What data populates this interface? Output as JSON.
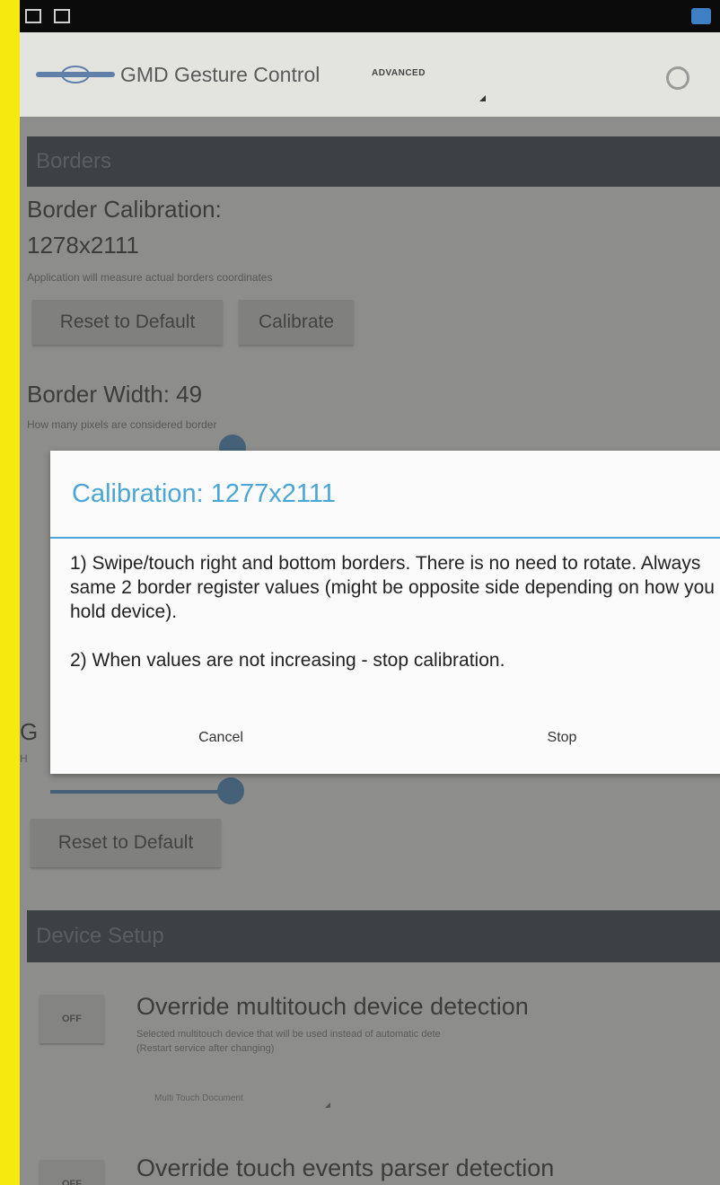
{
  "action_bar": {
    "app_title": "GMD Gesture Control",
    "mode_label": "ADVANCED",
    "settings_icon": "wrench-icon",
    "logo_icon": "gmd-logo-icon"
  },
  "borders_section": {
    "header": "Borders",
    "calibration": {
      "title": "Border Calibration:",
      "value": "1278x2111",
      "description": "Application will measure actual borders coordinates",
      "reset_label": "Reset to Default",
      "calibrate_label": "Calibrate"
    },
    "border_width": {
      "title": "Border Width: 49",
      "description": "How many pixels are considered border"
    }
  },
  "gesture_section": {
    "title_letter": "G",
    "hint_letter": "H",
    "reset_label": "Reset to Default"
  },
  "device_setup": {
    "header": "Device Setup",
    "rows": [
      {
        "badge": "OFF",
        "title": "Override multitouch device detection",
        "subtitle": "Selected multitouch device that will be used instead of automatic dete",
        "subtitle2": "(Restart service after changing)",
        "spinner": "Multi Touch Document"
      },
      {
        "badge": "OFF",
        "title": "Override touch events parser detection"
      }
    ]
  },
  "dialog": {
    "title": "Calibration: 1277x2111",
    "body_1": "1) Swipe/touch right and bottom borders. There is no need to rotate. Always same 2 border register values (might be opposite side depending on how you hold device).",
    "body_2": "2) When values are not increasing - stop calibration.",
    "cancel_label": "Cancel",
    "stop_label": "Stop"
  },
  "colors": {
    "accent": "#49a6d6",
    "frame_border": "#f6e90f",
    "section_header": "#4c5258"
  }
}
